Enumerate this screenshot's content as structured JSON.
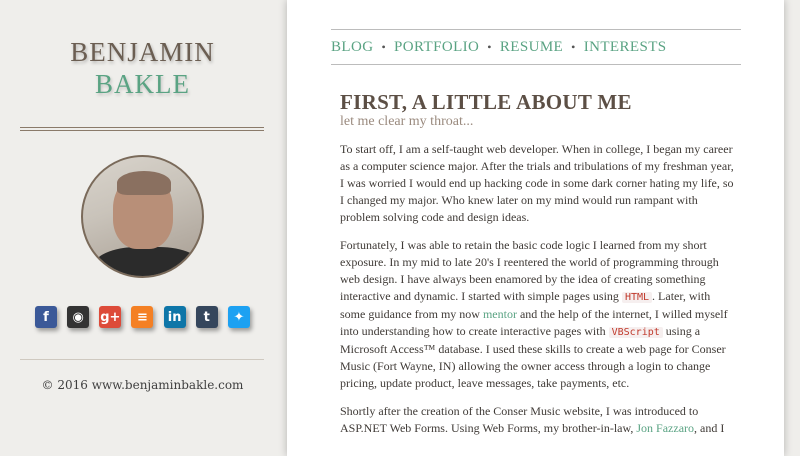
{
  "sidebar": {
    "first_name": "BENJAMIN",
    "last_name": "BAKLE",
    "copyright": "© 2016 www.benjaminbakle.com",
    "social": [
      {
        "name": "facebook-icon",
        "glyph": "f",
        "color": "#3b5998"
      },
      {
        "name": "github-icon",
        "glyph": "◉",
        "color": "#333333"
      },
      {
        "name": "google-plus-icon",
        "glyph": "g+",
        "color": "#dd4b39"
      },
      {
        "name": "stackoverflow-icon",
        "glyph": "≡",
        "color": "#f48024"
      },
      {
        "name": "linkedin-icon",
        "glyph": "in",
        "color": "#0e76a8"
      },
      {
        "name": "tumblr-icon",
        "glyph": "t",
        "color": "#35465c"
      },
      {
        "name": "twitter-icon",
        "glyph": "✦",
        "color": "#1da1f2"
      }
    ]
  },
  "nav": {
    "items": [
      "BLOG",
      "PORTFOLIO",
      "RESUME",
      "INTERESTS"
    ]
  },
  "main": {
    "heading": "FIRST, A LITTLE ABOUT ME",
    "subheading": "let me clear my throat...",
    "p1": "To start off, I am a self-taught web developer. When in college, I began my career as a computer science major. After the trials and tribulations of my freshman year, I was worried I would end up hacking code in some dark corner hating my life, so I changed my major. Who knew later on my mind would run rampant with problem solving code and design ideas.",
    "p2": {
      "a": "Fortunately, I was able to retain the basic code logic I learned from my short exposure. In my mid to late 20's I reentered the world of programming through web design. I have always been enamored by the idea of creating something interactive and dynamic. I started with simple pages using ",
      "code1": "HTML",
      "b": ". Later, with some guidance from my now ",
      "link": "mentor",
      "c": " and the help of the internet, I willed myself into understanding how to create interactive pages with ",
      "code2": "VBScript",
      "d": " using a Microsoft Access™ database. I used these skills to create a web page for Conser Music (Fort Wayne, IN) allowing the owner access through a login to change pricing, update product, leave messages, take payments, etc."
    },
    "p3": {
      "a": "Shortly after the creation of the Conser Music website, I was introduced to ASP.NET Web Forms. Using Web Forms, my brother-in-law, ",
      "link": "Jon Fazzaro",
      "b": ", and I"
    }
  }
}
